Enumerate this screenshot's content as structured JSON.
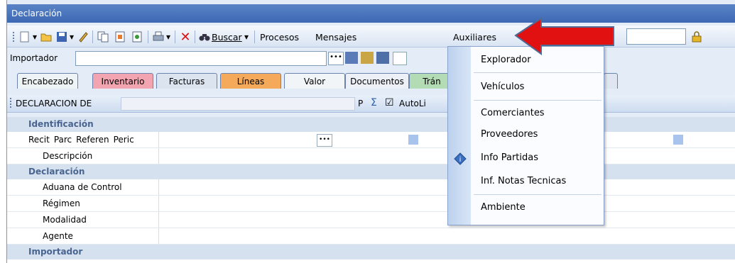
{
  "window": {
    "title": "Declaración"
  },
  "toolbar": {
    "buscar_label": "Buscar",
    "menus": [
      "Procesos",
      "Mensajes",
      "Auxiliares"
    ]
  },
  "importer": {
    "label": "Importador",
    "value": ""
  },
  "tabs": [
    "Encabezado",
    "Inventario",
    "Facturas",
    "Líneas",
    "Valor",
    "Documentos",
    "Trán"
  ],
  "subbar": {
    "label": "DECLARACION DE",
    "p": "P",
    "sigma": "Σ",
    "check": "☑",
    "auto": "AutoLi"
  },
  "grid": {
    "sections": [
      "Identificación",
      "Declaración",
      "Importador"
    ],
    "ident_headers": [
      "Recit",
      "Parc",
      "Referen",
      "Peric"
    ],
    "ident_rows": [
      "Descripción"
    ],
    "decl_rows": [
      "Aduana de Control",
      "Régimen",
      "Modalidad",
      "Agente"
    ]
  },
  "dropdown": {
    "items": [
      "Explorador",
      "Vehículos",
      "Comerciantes",
      "Proveedores",
      "Info Partidas",
      "Inf. Notas Tecnicas",
      "Ambiente"
    ]
  },
  "colors": {
    "title_bar": "#4a76bd",
    "arrow": "#e01010",
    "accent": "#cfe0f5"
  }
}
